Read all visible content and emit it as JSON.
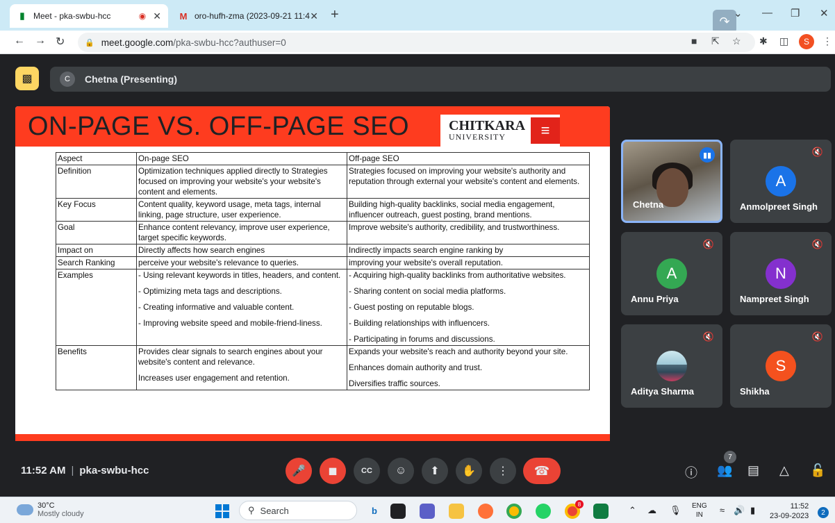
{
  "browser": {
    "tabs": [
      {
        "title": "Meet - pka-swbu-hcc",
        "favicon": "meet-icon"
      },
      {
        "title": "oro-hufh-zma (2023-09-21 11:4",
        "favicon": "gmail-icon"
      }
    ],
    "new_tab": "+",
    "window_controls": [
      "⌄",
      "—",
      "❐",
      "✕"
    ],
    "address": {
      "host": "meet.google.com",
      "path": "/pka-swbu-hcc?authuser=0"
    },
    "profile_initial": "S"
  },
  "meet": {
    "presenter_initial": "C",
    "presenter_label": "Chetna (Presenting)",
    "time": "11:52 AM",
    "meeting_code": "pka-swbu-hcc",
    "participant_count": "7",
    "colors": {
      "accent_red": "#ea4335",
      "panel": "#3c4043",
      "bg": "#202124",
      "speaking_border": "#8ab4f8"
    }
  },
  "slide": {
    "title": "ON-PAGE VS. OFF-PAGE SEO",
    "logo_name": "CHITKARA",
    "logo_sub": "UNIVERSITY",
    "header_color": "#fe3c1f",
    "table": {
      "headers": [
        "Aspect",
        "On-page SEO",
        "Off-page SEO"
      ],
      "rows": [
        {
          "aspect": "Definition",
          "on": [
            "Optimization techniques applied directly to Strategies focused on improving your website's your website's content and elements."
          ],
          "off": [
            "Strategies focused on improving your website's authority and reputation through external your website's content and elements."
          ]
        },
        {
          "aspect": "Key Focus",
          "on": [
            "Content quality, keyword usage, meta tags, internal linking, page structure, user experience."
          ],
          "off": [
            "Building high-quality backlinks, social media engagement, influencer outreach, guest posting, brand mentions."
          ]
        },
        {
          "aspect": "Goal",
          "on": [
            "Enhance content relevancy, improve user experience, target specific keywords."
          ],
          "off": [
            "Improve website's authority, credibility, and trustworthiness."
          ]
        },
        {
          "aspect": "Impact on",
          "on": [
            "Directly affects how search engines"
          ],
          "off": [
            "Indirectly impacts search engine ranking by"
          ]
        },
        {
          "aspect": "Search Ranking",
          "on": [
            "perceive your website's relevance to queries."
          ],
          "off": [
            "improving your website's overall reputation."
          ]
        },
        {
          "aspect": "Examples",
          "on": [
            "- Using relevant keywords in titles, headers, and content.",
            "- Optimizing meta tags and descriptions.",
            "- Creating informative and valuable content.",
            "- Improving website speed and mobile-friend-liness."
          ],
          "off": [
            "- Acquiring high-quality backlinks from authoritative websites.",
            "- Sharing content on social media platforms.",
            "- Guest posting on reputable blogs.",
            "- Building relationships with influencers.",
            "- Participating in forums and discussions."
          ]
        },
        {
          "aspect": "Benefits",
          "on": [
            "Provides clear signals to search engines about your website's content and relevance.",
            "Increases user engagement and retention."
          ],
          "off": [
            "Expands your website's reach and authority beyond your site.",
            "Enhances domain authority and trust.",
            "Diversifies traffic sources."
          ]
        }
      ]
    }
  },
  "participants": [
    {
      "name": "Chetna",
      "type": "video",
      "speaking": true
    },
    {
      "name": "Anmolpreet Singh",
      "initial": "A",
      "color": "#1a73e8",
      "muted": true
    },
    {
      "name": "Annu Priya",
      "initial": "A",
      "color": "#34a853",
      "muted": true
    },
    {
      "name": "Nampreet Singh",
      "initial": "N",
      "color": "#8430ce",
      "muted": true
    },
    {
      "name": "Aditya Sharma",
      "type": "photo",
      "muted": true
    },
    {
      "name": "Shikha",
      "initial": "S",
      "color": "#f4511e",
      "muted": true
    }
  ],
  "taskbar": {
    "temp": "30°C",
    "weather": "Mostly cloudy",
    "search_placeholder": "Search",
    "lang_top": "ENG",
    "lang_bottom": "IN",
    "time": "11:52",
    "date": "23-09-2023",
    "notification_count": "2",
    "chrome_badge": "8"
  }
}
